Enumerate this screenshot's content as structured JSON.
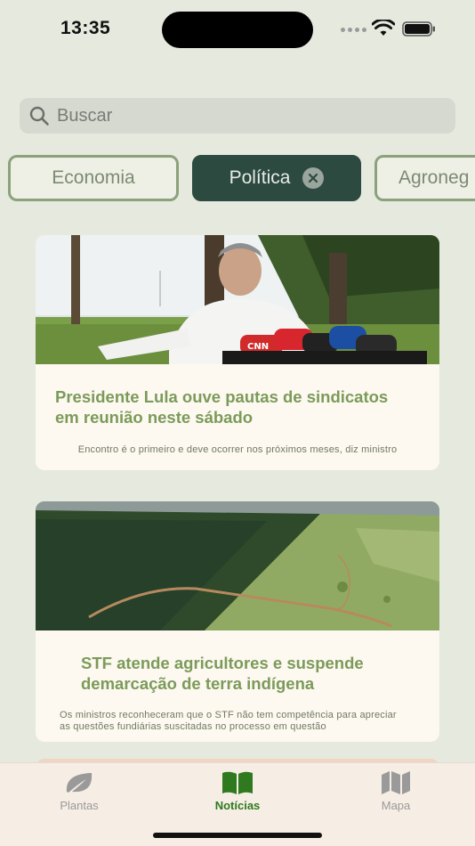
{
  "status_bar": {
    "time": "13:35"
  },
  "search": {
    "placeholder": "Buscar"
  },
  "chips": [
    {
      "label": "Economia",
      "active": false
    },
    {
      "label": "Política",
      "active": true
    },
    {
      "label": "Agroneg",
      "active": false
    }
  ],
  "articles": [
    {
      "title_line1": "Presidente Lula ouve pautas de sindicatos",
      "title_line2": "em reunião neste sábado",
      "subtitle": "Encontro é o primeiro e deve ocorrer nos próximos meses, diz ministro",
      "image_icon": "press-conference-photo"
    },
    {
      "title_line1": "STF atende agricultores e suspende",
      "title_line2": "demarcação de terra indígena",
      "subtitle_line1": "Os ministros reconheceram que o STF não tem competência para apreciar",
      "subtitle_line2": "as questões fundiárias suscitadas no processo em questão",
      "image_icon": "aerial-forest-photo"
    }
  ],
  "tab_bar": {
    "tabs": [
      {
        "label": "Plantas",
        "icon": "leaf-icon",
        "active": false
      },
      {
        "label": "Notícias",
        "icon": "book-icon",
        "active": true
      },
      {
        "label": "Mapa",
        "icon": "map-icon",
        "active": false
      }
    ]
  },
  "colors": {
    "background": "#e6e9de",
    "accent_dark": "#2d4a40",
    "title_green": "#7b9b5a",
    "active_tab": "#2f7a1f"
  }
}
